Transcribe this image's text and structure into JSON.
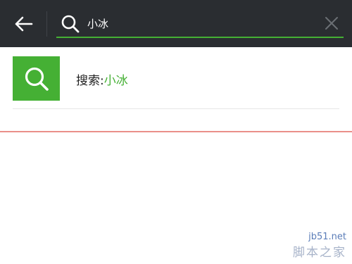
{
  "topbar": {
    "back_icon": "arrow-left-icon",
    "search_icon": "search-icon",
    "query": "小冰",
    "clear_icon": "close-icon"
  },
  "result": {
    "icon": "search-icon",
    "prefix": "搜索:",
    "keyword": "小冰"
  },
  "watermark": {
    "site": "jb51.net",
    "brand": "脚本之家"
  },
  "colors": {
    "topbar_bg": "#2a2d31",
    "accent_green": "#45b034",
    "divider_red": "#ea8f89"
  }
}
